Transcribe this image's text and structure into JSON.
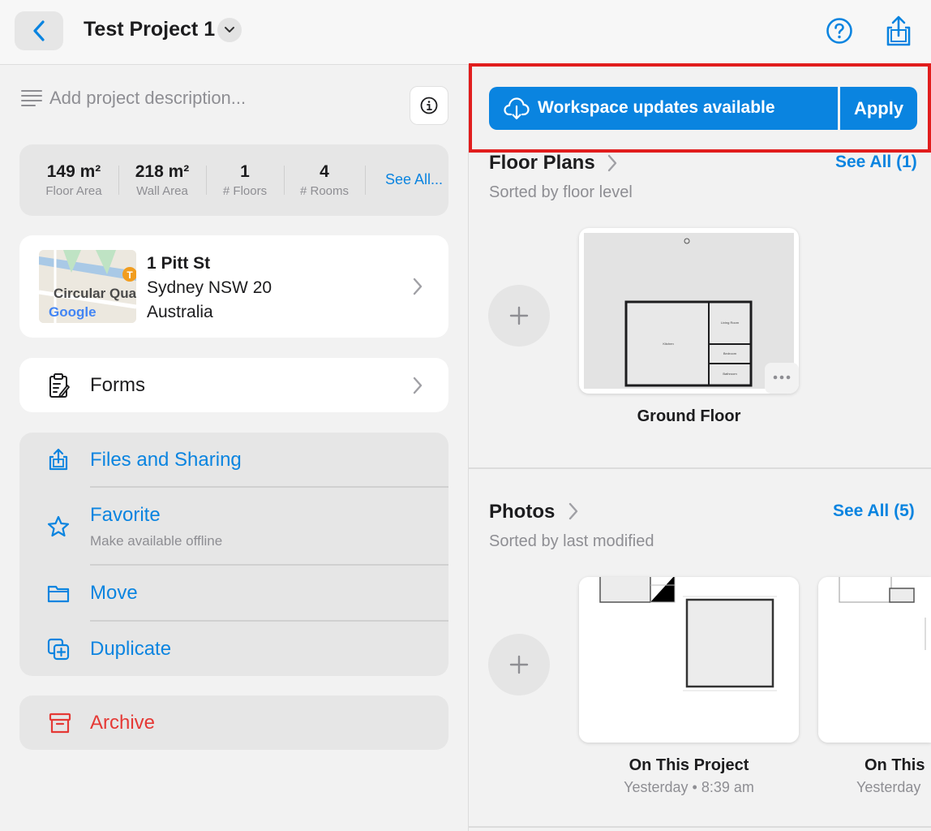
{
  "header": {
    "project_title": "Test Project 1"
  },
  "description": {
    "placeholder": "Add project description..."
  },
  "stats": [
    {
      "value": "149 m²",
      "label": "Floor Area"
    },
    {
      "value": "218 m²",
      "label": "Wall Area"
    },
    {
      "value": "1",
      "label": "# Floors"
    },
    {
      "value": "4",
      "label": "# Rooms"
    }
  ],
  "stats_see_all": "See All...",
  "address": {
    "line1": "1 Pitt St",
    "line2": "Sydney NSW 20",
    "line3": "Australia",
    "map_label": "Circular Qua",
    "map_brand": "Google",
    "map_badge": "T"
  },
  "forms": {
    "label": "Forms"
  },
  "actions": {
    "files_sharing": "Files and Sharing",
    "favorite": "Favorite",
    "favorite_sub": "Make available offline",
    "move": "Move",
    "duplicate": "Duplicate",
    "archive": "Archive"
  },
  "banner": {
    "text": "Workspace updates available",
    "apply": "Apply"
  },
  "floor_plans": {
    "title": "Floor Plans",
    "subtitle": "Sorted by floor level",
    "see_all": "See All (1)",
    "items": [
      {
        "name": "Ground Floor",
        "rooms": [
          "Kitchen",
          "Living Room",
          "Bedroom",
          "Bathroom"
        ]
      }
    ]
  },
  "photos": {
    "title": "Photos",
    "subtitle": "Sorted by last modified",
    "see_all": "See All (5)",
    "items": [
      {
        "title": "On This Project",
        "meta": "Yesterday • 8:39 am"
      },
      {
        "title": "On This",
        "meta": "Yesterday"
      }
    ]
  },
  "colors": {
    "accent": "#0a84e0",
    "danger": "#e53935",
    "highlight_frame": "#e11d1d"
  }
}
